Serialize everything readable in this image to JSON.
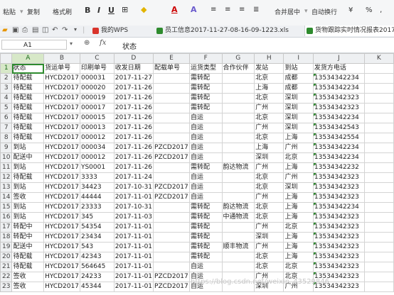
{
  "ribbon": {
    "paste": "粘贴",
    "copy": "复制",
    "format_painter": "格式刷",
    "bold": "B",
    "italic": "I",
    "underline": "U",
    "font_color": "A",
    "clear": "A",
    "merge_center": "合并居中",
    "wrap_text": "自动换行",
    "currency": "¥",
    "percent": "%"
  },
  "tabs": [
    {
      "label": "我的WPS"
    },
    {
      "label": "员工信息2017-11-27-08-16-09-1223.xls"
    },
    {
      "label": "货物跟踪实时情况报表2017"
    }
  ],
  "formula_bar": {
    "cell_ref": "A1",
    "fx": "fx",
    "formula": "状态"
  },
  "columns": [
    "A",
    "B",
    "C",
    "D",
    "E",
    "F",
    "G",
    "H",
    "I",
    "J",
    "K"
  ],
  "rows": [
    [
      "状态",
      "货运单号",
      "印刷单号",
      "收发日期",
      "配载单号",
      "运货类型",
      "合作伙伴",
      "发站",
      "到站",
      "发货方电话",
      ""
    ],
    [
      "待配载",
      "HYCD2017",
      "000031",
      "2017-11-27",
      "",
      "需转配",
      "",
      "北京",
      "成都",
      "13534342234",
      ""
    ],
    [
      "待配载",
      "HYCD2017",
      "000020",
      "2017-11-26",
      "",
      "需转配",
      "",
      "上海",
      "成都",
      "13534342234",
      ""
    ],
    [
      "待配载",
      "HYCD2017",
      "000019",
      "2017-11-26",
      "",
      "需转配",
      "",
      "北京",
      "深圳",
      "13534342323",
      ""
    ],
    [
      "待配载",
      "HYCD2017",
      "000017",
      "2017-11-26",
      "",
      "需转配",
      "",
      "广州",
      "深圳",
      "13534342323",
      ""
    ],
    [
      "待配载",
      "HYCD2017",
      "000015",
      "2017-11-26",
      "",
      "自运",
      "",
      "北京",
      "深圳",
      "13534342234",
      ""
    ],
    [
      "待配载",
      "HYCD2017",
      "000013",
      "2017-11-26",
      "",
      "自运",
      "",
      "广州",
      "深圳",
      "13534342543",
      ""
    ],
    [
      "待配载",
      "HYCD2017",
      "000012",
      "2017-11-26",
      "",
      "自运",
      "",
      "北京",
      "上海",
      "13534342554",
      ""
    ],
    [
      "到站",
      "HYCD2017",
      "000034",
      "2017-11-26",
      "PZCD2017",
      "自运",
      "",
      "上海",
      "广州",
      "13534342234",
      ""
    ],
    [
      "配送中",
      "HYCD2017",
      "000012",
      "2017-11-26",
      "PZCD2017",
      "自运",
      "",
      "深圳",
      "北京",
      "13534342234",
      ""
    ],
    [
      "到站",
      "HYCD2017",
      "YS0001",
      "2017-11-26",
      "",
      "需转配",
      "韵达物流",
      "广州",
      "上海",
      "13534342232",
      ""
    ],
    [
      "待配载",
      "HYCD2017",
      "3333",
      "2017-11-24",
      "",
      "自运",
      "",
      "北京",
      "广州",
      "13534342323",
      ""
    ],
    [
      "到站",
      "HYCD2017",
      "34423",
      "2017-10-31",
      "PZCD2017",
      "自运",
      "",
      "北京",
      "深圳",
      "13534342323",
      ""
    ],
    [
      "签收",
      "HYCD2017",
      "44444",
      "2017-11-01",
      "PZCD2017",
      "自运",
      "",
      "广州",
      "上海",
      "13534342323",
      ""
    ],
    [
      "到站",
      "HYCD2017",
      "23333",
      "2017-10-31",
      "",
      "需转配",
      "韵达物流",
      "北京",
      "上海",
      "13534342234",
      ""
    ],
    [
      "到站",
      "HYCD2017",
      "345",
      "2017-11-03",
      "",
      "需转配",
      "中通物流",
      "北京",
      "上海",
      "13534342323",
      ""
    ],
    [
      "转配中",
      "HYCD2017",
      "54354",
      "2017-11-01",
      "",
      "需转配",
      "",
      "广州",
      "北京",
      "13534342323",
      ""
    ],
    [
      "转配中",
      "HYCD2017",
      "23434",
      "2017-11-01",
      "",
      "需转配",
      "",
      "深圳",
      "上海",
      "13534342323",
      ""
    ],
    [
      "配送中",
      "HYCD2017",
      "543",
      "2017-11-01",
      "",
      "需转配",
      "顺丰物流",
      "广州",
      "上海",
      "13534342323",
      ""
    ],
    [
      "待配载",
      "HYCD2017",
      "42343",
      "2017-11-01",
      "",
      "需转配",
      "",
      "北京",
      "上海",
      "13534342323",
      ""
    ],
    [
      "待配载",
      "HYCD2017",
      "564645",
      "2017-11-01",
      "",
      "自运",
      "",
      "北京",
      "北京",
      "13534342323",
      ""
    ],
    [
      "签收",
      "HYCD2017",
      "24233",
      "2017-11-01",
      "PZCD2017",
      "自运",
      "",
      "广州",
      "北京",
      "13534342323",
      ""
    ],
    [
      "签收",
      "HYCD2017",
      "45344",
      "2017-11-01",
      "PZCD2017",
      "自运",
      "",
      "深圳",
      "广州",
      "13534342323",
      ""
    ]
  ],
  "watermark": "https://blog.csdn.net/weixin_43529846",
  "colors": {
    "accent": "#2e8b2e",
    "header_bg": "#eef0f2",
    "selected_header": "#d7e8c8"
  }
}
